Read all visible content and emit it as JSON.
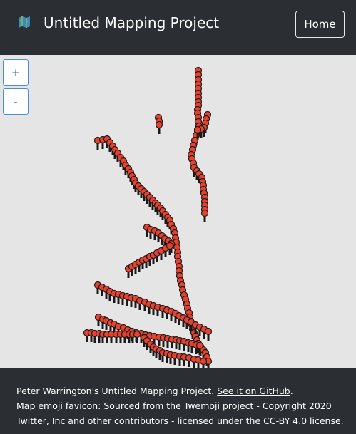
{
  "header": {
    "title": "Untitled Mapping Project",
    "home_label": "Home"
  },
  "map": {
    "zoom_in_label": "+",
    "zoom_out_label": "-",
    "marker_color": "#e8412c",
    "marker_outline": "#1a1a1a"
  },
  "footer": {
    "line1_prefix": "Peter Warrington's Untitled Mapping Project. ",
    "github_link": "See it on GitHub",
    "line1_suffix": ".",
    "line2_prefix": "Map emoji favicon: Sourced from the ",
    "twemoji_link": "Twemoji project",
    "line2_middle": " - Copyright 2020 Twitter, Inc and other contributors - licensed under the ",
    "license_link": "CC-BY 4.0",
    "line2_suffix": " license."
  }
}
